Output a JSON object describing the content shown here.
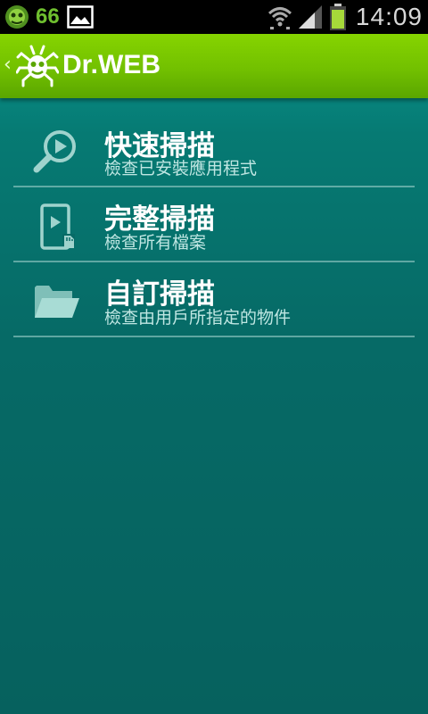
{
  "status_bar": {
    "notification_count": "66",
    "time": "14:09",
    "icons": [
      "drweb-spider-icon",
      "gallery-icon",
      "wifi-icon",
      "signal-icon",
      "battery-icon"
    ]
  },
  "action_bar": {
    "title": "Dr.WEB",
    "icons": [
      "back-chevron-icon",
      "drweb-spider-logo"
    ]
  },
  "menu": {
    "items": [
      {
        "title": "快速掃描",
        "subtitle": "檢查已安裝應用程式",
        "icon": "magnifier-play-icon"
      },
      {
        "title": "完整掃描",
        "subtitle": "檢查所有檔案",
        "icon": "phone-sdcard-icon"
      },
      {
        "title": "自訂掃描",
        "subtitle": "檢查由用戶所指定的物件",
        "icon": "folder-open-icon"
      }
    ]
  },
  "colors": {
    "status_bar_bg": "#000000",
    "action_bar_green": "#72c000",
    "background_teal": "#06615e",
    "subtitle_text": "#bfe6e2",
    "icon_tint": "#9fd3cd"
  }
}
